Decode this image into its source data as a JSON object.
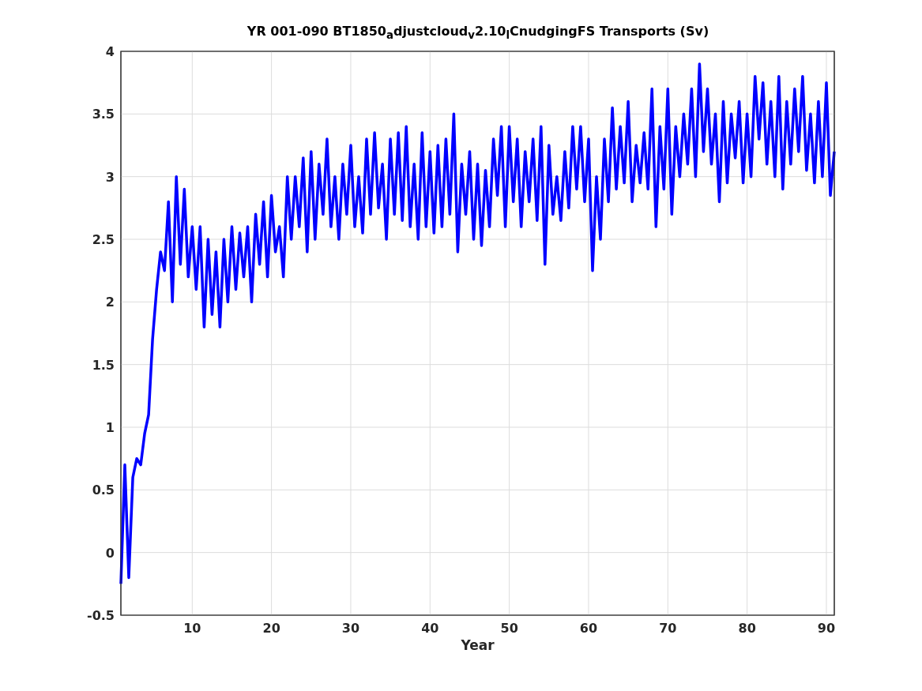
{
  "figure": {
    "chart_data": {
      "type": "line",
      "title": "YR 001-090 BT1850$_{a}$djustcloud$_{v}$2.10$_{l}$CnudgingFS Transports (Sv)",
      "xlabel": "Year",
      "x": [
        1,
        1.5,
        2,
        2.5,
        3,
        3.5,
        4,
        4.5,
        5,
        5.5,
        6,
        6.5,
        7,
        7.5,
        8,
        8.5,
        9,
        9.5,
        10,
        10.5,
        11,
        11.5,
        12,
        12.5,
        13,
        13.5,
        14,
        14.5,
        15,
        15.5,
        16,
        16.5,
        17,
        17.5,
        18,
        18.5,
        19,
        19.5,
        20,
        20.5,
        21,
        21.5,
        22,
        22.5,
        23,
        23.5,
        24,
        24.5,
        25,
        25.5,
        26,
        26.5,
        27,
        27.5,
        28,
        28.5,
        29,
        29.5,
        30,
        30.5,
        31,
        31.5,
        32,
        32.5,
        33,
        33.5,
        34,
        34.5,
        35,
        35.5,
        36,
        36.5,
        37,
        37.5,
        38,
        38.5,
        39,
        39.5,
        40,
        40.5,
        41,
        41.5,
        42,
        42.5,
        43,
        43.5,
        44,
        44.5,
        45,
        45.5,
        46,
        46.5,
        47,
        47.5,
        48,
        48.5,
        49,
        49.5,
        50,
        50.5,
        51,
        51.5,
        52,
        52.5,
        53,
        53.5,
        54,
        54.5,
        55,
        55.5,
        56,
        56.5,
        57,
        57.5,
        58,
        58.5,
        59,
        59.5,
        60,
        60.5,
        61,
        61.5,
        62,
        62.5,
        63,
        63.5,
        64,
        64.5,
        65,
        65.5,
        66,
        66.5,
        67,
        67.5,
        68,
        68.5,
        69,
        69.5,
        70,
        70.5,
        71,
        71.5,
        72,
        72.5,
        73,
        73.5,
        74,
        74.5,
        75,
        75.5,
        76,
        76.5,
        77,
        77.5,
        78,
        78.5,
        79,
        79.5,
        80,
        80.5,
        81,
        81.5,
        82,
        82.5,
        83,
        83.5,
        84,
        84.5,
        85,
        85.5,
        86,
        86.5,
        87,
        87.5,
        88,
        88.5,
        89,
        89.5,
        90,
        90.5,
        91
      ],
      "series": [
        {
          "color": "#0000ff",
          "values": [
            -0.25,
            0.7,
            -0.2,
            0.6,
            0.75,
            0.7,
            0.95,
            1.1,
            1.7,
            2.1,
            2.4,
            2.25,
            2.8,
            2.0,
            3.0,
            2.3,
            2.9,
            2.2,
            2.6,
            2.1,
            2.6,
            1.8,
            2.5,
            1.9,
            2.4,
            1.8,
            2.5,
            2.0,
            2.6,
            2.1,
            2.55,
            2.2,
            2.6,
            2.0,
            2.7,
            2.3,
            2.8,
            2.2,
            2.85,
            2.4,
            2.6,
            2.2,
            3.0,
            2.5,
            3.0,
            2.6,
            3.15,
            2.4,
            3.2,
            2.5,
            3.1,
            2.7,
            3.3,
            2.6,
            3.0,
            2.5,
            3.1,
            2.7,
            3.25,
            2.6,
            3.0,
            2.55,
            3.3,
            2.7,
            3.35,
            2.75,
            3.1,
            2.5,
            3.3,
            2.7,
            3.35,
            2.65,
            3.4,
            2.6,
            3.1,
            2.5,
            3.35,
            2.6,
            3.2,
            2.55,
            3.25,
            2.6,
            3.3,
            2.7,
            3.5,
            2.4,
            3.1,
            2.7,
            3.2,
            2.5,
            3.1,
            2.45,
            3.05,
            2.6,
            3.3,
            2.85,
            3.4,
            2.6,
            3.4,
            2.8,
            3.3,
            2.6,
            3.2,
            2.8,
            3.3,
            2.65,
            3.4,
            2.3,
            3.25,
            2.7,
            3.0,
            2.65,
            3.2,
            2.75,
            3.4,
            2.9,
            3.4,
            2.8,
            3.3,
            2.25,
            3.0,
            2.5,
            3.3,
            2.8,
            3.55,
            2.9,
            3.4,
            2.95,
            3.6,
            2.8,
            3.25,
            2.95,
            3.35,
            2.9,
            3.7,
            2.6,
            3.4,
            2.9,
            3.7,
            2.7,
            3.4,
            3.0,
            3.5,
            3.1,
            3.7,
            3.0,
            3.9,
            3.2,
            3.7,
            3.1,
            3.5,
            2.8,
            3.6,
            2.95,
            3.5,
            3.15,
            3.6,
            2.95,
            3.5,
            3.0,
            3.8,
            3.3,
            3.75,
            3.1,
            3.6,
            3.0,
            3.8,
            2.9,
            3.6,
            3.1,
            3.7,
            3.2,
            3.8,
            3.05,
            3.5,
            2.95,
            3.6,
            3.0,
            3.75,
            2.85,
            3.2
          ]
        }
      ],
      "grid": true,
      "xlim": [
        1,
        91
      ],
      "ylim": [
        -0.5,
        4
      ],
      "xticks": [
        10,
        20,
        30,
        40,
        50,
        60,
        70,
        80,
        90
      ],
      "yticks": [
        {
          "value": -0.5,
          "label": "-0.5"
        },
        {
          "value": 0,
          "label": "0"
        },
        {
          "value": 0.5,
          "label": "0.5"
        },
        {
          "value": 1,
          "label": "1"
        },
        {
          "value": 1.5,
          "label": "1.5"
        },
        {
          "value": 2,
          "label": "2"
        },
        {
          "value": 2.5,
          "label": "2.5"
        },
        {
          "value": 3,
          "label": "3"
        },
        {
          "value": 3.5,
          "label": "3.5"
        },
        {
          "value": 4,
          "label": "4"
        }
      ]
    }
  }
}
